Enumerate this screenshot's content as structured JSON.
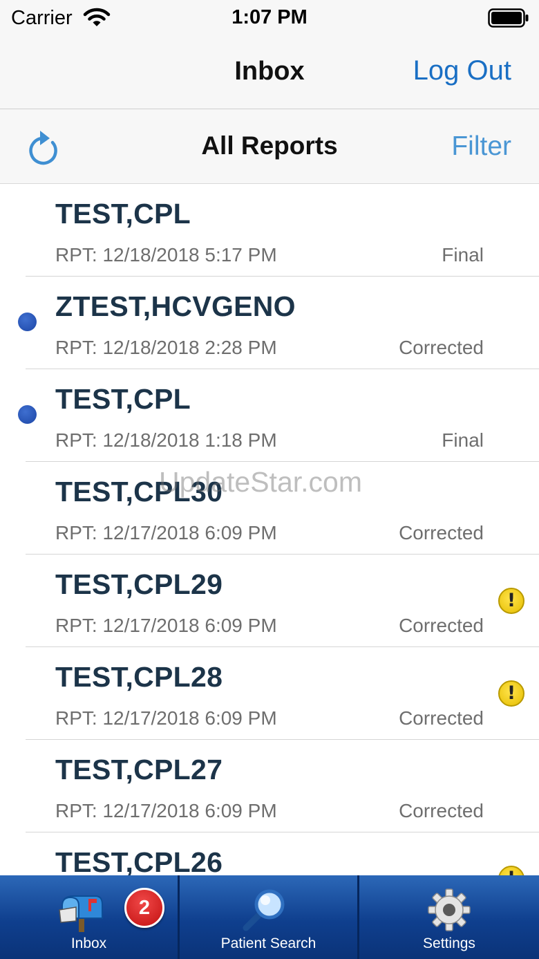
{
  "status_bar": {
    "carrier": "Carrier",
    "time": "1:07 PM"
  },
  "nav": {
    "title": "Inbox",
    "logout_label": "Log Out"
  },
  "sub_bar": {
    "title": "All Reports",
    "filter_label": "Filter"
  },
  "reports": [
    {
      "name": "TEST,CPL",
      "rpt": "RPT: 12/18/2018 5:17 PM",
      "status": "Final",
      "unread": false,
      "warning": false
    },
    {
      "name": "ZTEST,HCVGENO",
      "rpt": "RPT: 12/18/2018 2:28 PM",
      "status": "Corrected",
      "unread": true,
      "warning": false
    },
    {
      "name": "TEST,CPL",
      "rpt": "RPT: 12/18/2018 1:18 PM",
      "status": "Final",
      "unread": true,
      "warning": false
    },
    {
      "name": "TEST,CPL30",
      "rpt": "RPT: 12/17/2018 6:09 PM",
      "status": "Corrected",
      "unread": false,
      "warning": false
    },
    {
      "name": "TEST,CPL29",
      "rpt": "RPT: 12/17/2018 6:09 PM",
      "status": "Corrected",
      "unread": false,
      "warning": true
    },
    {
      "name": "TEST,CPL28",
      "rpt": "RPT: 12/17/2018 6:09 PM",
      "status": "Corrected",
      "unread": false,
      "warning": true
    },
    {
      "name": "TEST,CPL27",
      "rpt": "RPT: 12/17/2018 6:09 PM",
      "status": "Corrected",
      "unread": false,
      "warning": false
    },
    {
      "name": "TEST,CPL26",
      "rpt": "",
      "status": "",
      "unread": false,
      "warning": true
    }
  ],
  "warning_glyph": "!",
  "watermark": "UpdateStar.com",
  "tabs": {
    "inbox": {
      "label": "Inbox",
      "badge": "2",
      "icon": "mailbox-icon"
    },
    "patient_search": {
      "label": "Patient Search",
      "icon": "magnifier-icon"
    },
    "settings": {
      "label": "Settings",
      "icon": "gear-icon"
    }
  },
  "colors": {
    "link": "#1a6fc4",
    "tab_bar": "#0f3f8e",
    "unread_dot": "#1c46a6",
    "warning": "#f2cf10",
    "badge": "#d11a1a"
  }
}
